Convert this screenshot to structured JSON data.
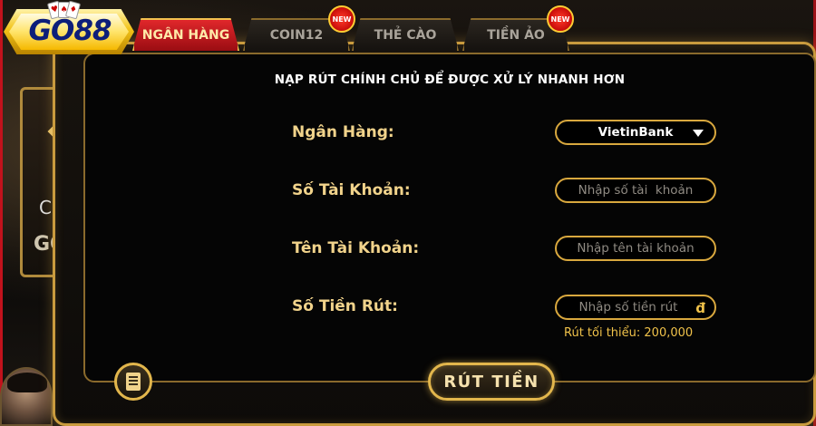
{
  "logo": {
    "text": "GO88"
  },
  "tabs": [
    {
      "label": "NGÂN HÀNG",
      "active": true,
      "new": false
    },
    {
      "label": "COIN12",
      "active": false,
      "new": true
    },
    {
      "label": "THẺ CÀO",
      "active": false,
      "new": false
    },
    {
      "label": "TIỀN ẢO",
      "active": false,
      "new": true
    }
  ],
  "new_badge_label": "NEW",
  "notice": "NẠP RÚT CHÍNH CHỦ ĐỂ ĐƯỢC XỬ LÝ NHANH HƠN",
  "form": {
    "bank_label": "Ngân Hàng:",
    "bank_value": "VietinBank",
    "account_number_label": "Số Tài Khoản:",
    "account_number_placeholder": "Nhập số tài  khoản",
    "account_name_label": "Tên Tài Khoản:",
    "account_name_placeholder": "Nhập tên tài khoản",
    "amount_label": "Số Tiền Rút:",
    "amount_placeholder": "Nhập số tiền rút",
    "currency_symbol": "đ",
    "min_note": "Rút tối thiểu: 200,000"
  },
  "withdraw_button": "RÚT TIỀN",
  "colors": {
    "gold": "#e2b64c",
    "active_tab": "#e0272b",
    "label": "#f1d38b"
  }
}
